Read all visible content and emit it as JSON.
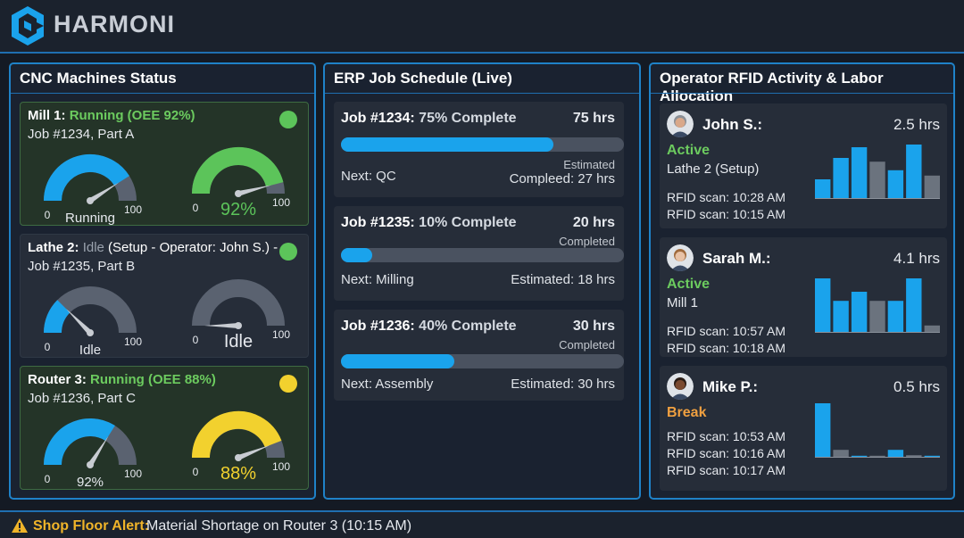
{
  "header": {
    "brand": "HARMONI"
  },
  "cnc": {
    "title": "CNC Machines Status",
    "machines": [
      {
        "name": "Mill 1:",
        "state": "Running (OEE 92%)",
        "extra": "",
        "job": "Job #1234, Part A",
        "status_color": "#5cc45a",
        "gauge1": {
          "level": 0.82,
          "color": "#1aa3ec",
          "label": "Running",
          "min": "0",
          "max": "100"
        },
        "gauge2": {
          "level": 0.92,
          "color": "#5cc45a",
          "label": "92%",
          "min": "0",
          "max": "100"
        }
      },
      {
        "name": "Lathe 2:",
        "state": "Idle",
        "extra": "(Setup - Operator: John S.) -",
        "job": "Job #1235, Part B",
        "status_color": "#5cc45a",
        "gauge1": {
          "level": 0.25,
          "color": "#1aa3ec",
          "label": "Idle",
          "min": "0",
          "max": "100"
        },
        "gauge2": {
          "level": 0.0,
          "color": "#1aa3ec",
          "label": "Idle",
          "min": "0",
          "max": "100"
        }
      },
      {
        "name": "Router 3:",
        "state": "Running (OEE 88%)",
        "extra": "",
        "job": "Job #1236, Part C",
        "status_color": "#f2d12e",
        "gauge1": {
          "level": 0.68,
          "color": "#1aa3ec",
          "label": "92%",
          "min": "0",
          "max": "100"
        },
        "gauge2": {
          "level": 0.88,
          "color": "#f2d12e",
          "label": "88%",
          "min": "0",
          "max": "100"
        }
      }
    ]
  },
  "erp": {
    "title": "ERP Job Schedule (Live)",
    "jobs": [
      {
        "job": "Job #1234:",
        "pct_text": "75% Complete",
        "progress": 0.75,
        "hours": "75 hrs",
        "hours_note": "",
        "next": "Next: QC",
        "est_top": "Estimated",
        "est": "Compleed: 27 hrs"
      },
      {
        "job": "Job #1235:",
        "pct_text": "10% Complete",
        "progress": 0.11,
        "hours": "20 hrs",
        "hours_note": "Completed",
        "next": "Next: Milling",
        "est_top": "",
        "est": "Estimated: 18 hrs"
      },
      {
        "job": "Job #1236:",
        "pct_text": "40% Complete",
        "progress": 0.4,
        "hours": "30 hrs",
        "hours_note": "Completed",
        "next": "Next: Assembly",
        "est_top": "",
        "est": "Estimated: 30 hrs"
      }
    ]
  },
  "operators": {
    "title": "Operator RFID Activity & Labor Allocation",
    "list": [
      {
        "name": "John S.:",
        "hours": "2.5 hrs",
        "status": "Active",
        "location": "Lathe 2 (Setup)",
        "scans": [
          "RFID scan: 10:28 AM",
          "RFID scan: 10:15 AM"
        ],
        "bars": [
          0.35,
          0.75,
          0.95,
          0.68,
          0.52,
          1.0,
          0.42
        ],
        "bar_colors": [
          "#1aa3ec",
          "#1aa3ec",
          "#1aa3ec",
          "#6b737e",
          "#1aa3ec",
          "#1aa3ec",
          "#6b737e"
        ],
        "avatar_skin": "#d9a88a",
        "avatar_hair": "#8a8f96"
      },
      {
        "name": "Sarah M.:",
        "hours": "4.1 hrs",
        "status": "Active",
        "location": "Mill 1",
        "scans": [
          "RFID scan: 10:57 AM",
          "RFID scan: 10:18 AM"
        ],
        "bars": [
          1.0,
          0.58,
          0.75,
          0.58,
          0.58,
          1.0,
          0.12
        ],
        "bar_colors": [
          "#1aa3ec",
          "#1aa3ec",
          "#1aa3ec",
          "#6b737e",
          "#1aa3ec",
          "#1aa3ec",
          "#6b737e"
        ],
        "avatar_skin": "#e8c2a6",
        "avatar_hair": "#a06a3c"
      },
      {
        "name": "Mike P.:",
        "hours": "0.5 hrs",
        "status": "Break",
        "location": "",
        "scans": [
          "RFID scan: 10:53 AM",
          "RFID scan: 10:16 AM",
          "RFID scan: 10:17 AM"
        ],
        "bars": [
          1.0,
          0.13,
          0.02,
          0.02,
          0.13,
          0.03,
          0.02
        ],
        "bar_colors": [
          "#1aa3ec",
          "#6b737e",
          "#1aa3ec",
          "#6b737e",
          "#1aa3ec",
          "#6b737e",
          "#1aa3ec"
        ],
        "avatar_skin": "#7a4a30",
        "avatar_hair": "#2a1d16"
      }
    ]
  },
  "alert": {
    "label": "Shop Floor Alert:",
    "message": "Material Shortage on Router 3 (10:15 AM)"
  }
}
